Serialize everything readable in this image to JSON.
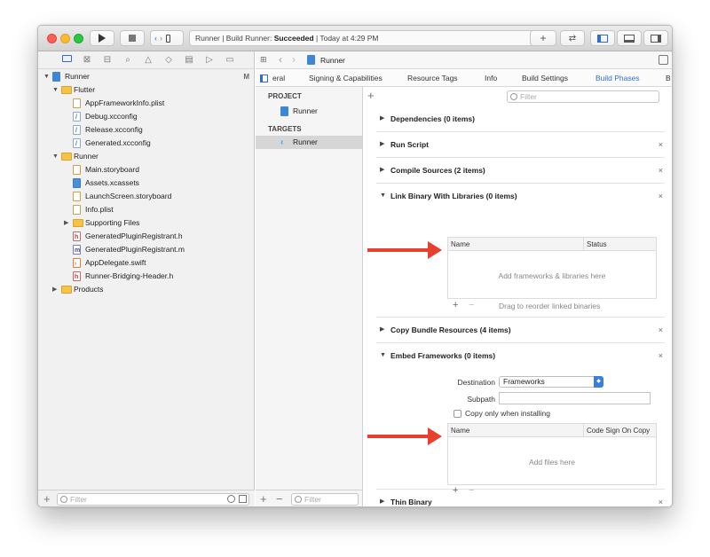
{
  "toolbar": {
    "scheme_target": "Runner",
    "status_prefix": "Runner | Build Runner: ",
    "status_bold": "Succeeded",
    "status_suffix": " | Today at 4:29 PM",
    "add_glyph": "+",
    "swap_glyph": "⇄"
  },
  "navigator": {
    "tree": [
      {
        "label": "Runner",
        "icon": "project",
        "level": 0,
        "disclosure": "open",
        "badge": "M"
      },
      {
        "label": "Flutter",
        "icon": "folder",
        "level": 1,
        "disclosure": "open"
      },
      {
        "label": "AppFrameworkInfo.plist",
        "icon": "plist",
        "level": 2
      },
      {
        "label": "Debug.xcconfig",
        "icon": "xcconfig",
        "level": 2
      },
      {
        "label": "Release.xcconfig",
        "icon": "xcconfig",
        "level": 2
      },
      {
        "label": "Generated.xcconfig",
        "icon": "xcconfig",
        "level": 2
      },
      {
        "label": "Runner",
        "icon": "folder",
        "level": 1,
        "disclosure": "open"
      },
      {
        "label": "Main.storyboard",
        "icon": "storyboard",
        "level": 2
      },
      {
        "label": "Assets.xcassets",
        "icon": "assets",
        "level": 2
      },
      {
        "label": "LaunchScreen.storyboard",
        "icon": "storyboard",
        "level": 2
      },
      {
        "label": "Info.plist",
        "icon": "plist",
        "level": 2
      },
      {
        "label": "Supporting Files",
        "icon": "folder",
        "level": 2,
        "disclosure": "closed"
      },
      {
        "label": "GeneratedPluginRegistrant.h",
        "icon": "h",
        "level": 2
      },
      {
        "label": "GeneratedPluginRegistrant.m",
        "icon": "m",
        "level": 2
      },
      {
        "label": "AppDelegate.swift",
        "icon": "swift",
        "level": 2
      },
      {
        "label": "Runner-Bridging-Header.h",
        "icon": "h",
        "level": 2
      },
      {
        "label": "Products",
        "icon": "folder",
        "level": 1,
        "disclosure": "closed"
      }
    ],
    "filter_placeholder": "Filter"
  },
  "jumpbar": {
    "crumb": "Runner"
  },
  "editor_tabs": [
    {
      "label": "eral",
      "active": false
    },
    {
      "label": "Signing & Capabilities",
      "active": false
    },
    {
      "label": "Resource Tags",
      "active": false
    },
    {
      "label": "Info",
      "active": false
    },
    {
      "label": "Build Settings",
      "active": false
    },
    {
      "label": "Build Phases",
      "active": true
    },
    {
      "label": "B",
      "active": false
    }
  ],
  "targets_list": {
    "project_header": "PROJECT",
    "project_item": "Runner",
    "targets_header": "TARGETS",
    "target_item": "Runner",
    "filter_placeholder": "Filter"
  },
  "phases": {
    "filter_placeholder": "Filter",
    "items": [
      {
        "title": "Dependencies (0 items)",
        "removable": false
      },
      {
        "title": "Run Script",
        "removable": true
      },
      {
        "title": "Compile Sources (2 items)",
        "removable": true
      },
      {
        "title": "Link Binary With Libraries (0 items)",
        "removable": true
      },
      {
        "title": "Copy Bundle Resources (4 items)",
        "removable": true
      },
      {
        "title": "Embed Frameworks (0 items)",
        "removable": true
      },
      {
        "title": "Thin Binary",
        "removable": true
      }
    ],
    "link": {
      "col_name": "Name",
      "col_status": "Status",
      "empty": "Add frameworks & libraries here",
      "drag_hint": "Drag to reorder linked binaries"
    },
    "embed": {
      "destination_label": "Destination",
      "destination_value": "Frameworks",
      "subpath_label": "Subpath",
      "subpath_value": "",
      "copy_only_label": "Copy only when installing",
      "col_name": "Name",
      "col_sign": "Code Sign On Copy",
      "empty": "Add files here"
    }
  },
  "colors": {
    "accent": "#2f6bd6",
    "arrow": "#e8402f",
    "close": "#fd5f57",
    "minimize": "#febb2e",
    "zoom": "#28c840"
  }
}
